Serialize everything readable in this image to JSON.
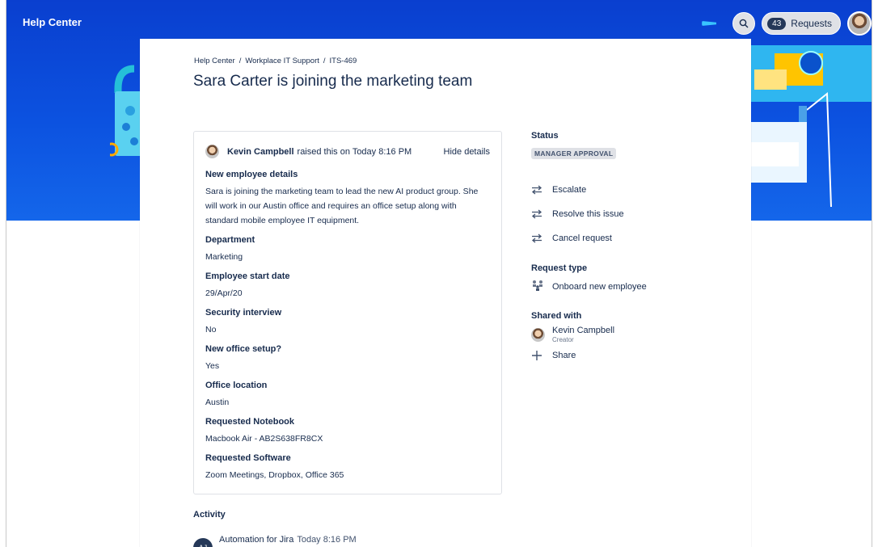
{
  "header": {
    "brand": "Help Center",
    "requests_count": "43",
    "requests_label": "Requests"
  },
  "breadcrumb": [
    "Help Center",
    "Workplace IT Support",
    "ITS-469"
  ],
  "request": {
    "title": "Sara Carter is joining the marketing team",
    "raised_by": "Kevin Campbell",
    "raised_text": "raised this on Today 8:16 PM",
    "hide_details": "Hide details",
    "fields": [
      {
        "label": "New employee details",
        "value": "Sara is joining the marketing team to lead the new AI product group.  She will work in our Austin office and requires an office setup along with standard mobile employee IT equipment."
      },
      {
        "label": "Department",
        "value": "Marketing"
      },
      {
        "label": "Employee start date",
        "value": "29/Apr/20"
      },
      {
        "label": "Security interview",
        "value": "No"
      },
      {
        "label": "New office setup?",
        "value": "Yes"
      },
      {
        "label": "Office location",
        "value": "Austin"
      },
      {
        "label": "Requested Notebook",
        "value": "Macbook Air - AB2S638FR8CX"
      },
      {
        "label": "Requested Software",
        "value": "Zoom Meetings, Dropbox, Office 365"
      }
    ]
  },
  "sidebar": {
    "status_heading": "Status",
    "status_value": "MANAGER APPROVAL",
    "actions": [
      "Escalate",
      "Resolve this issue",
      "Cancel request"
    ],
    "request_type_heading": "Request type",
    "request_type": "Onboard new employee",
    "shared_heading": "Shared with",
    "shared_user": "Kevin Campbell",
    "shared_role": "Creator",
    "share_label": "Share"
  },
  "activity": {
    "heading": "Activity",
    "author_initials": "AJ",
    "author": "Automation for Jira",
    "time": "Today 8:16 PM"
  }
}
